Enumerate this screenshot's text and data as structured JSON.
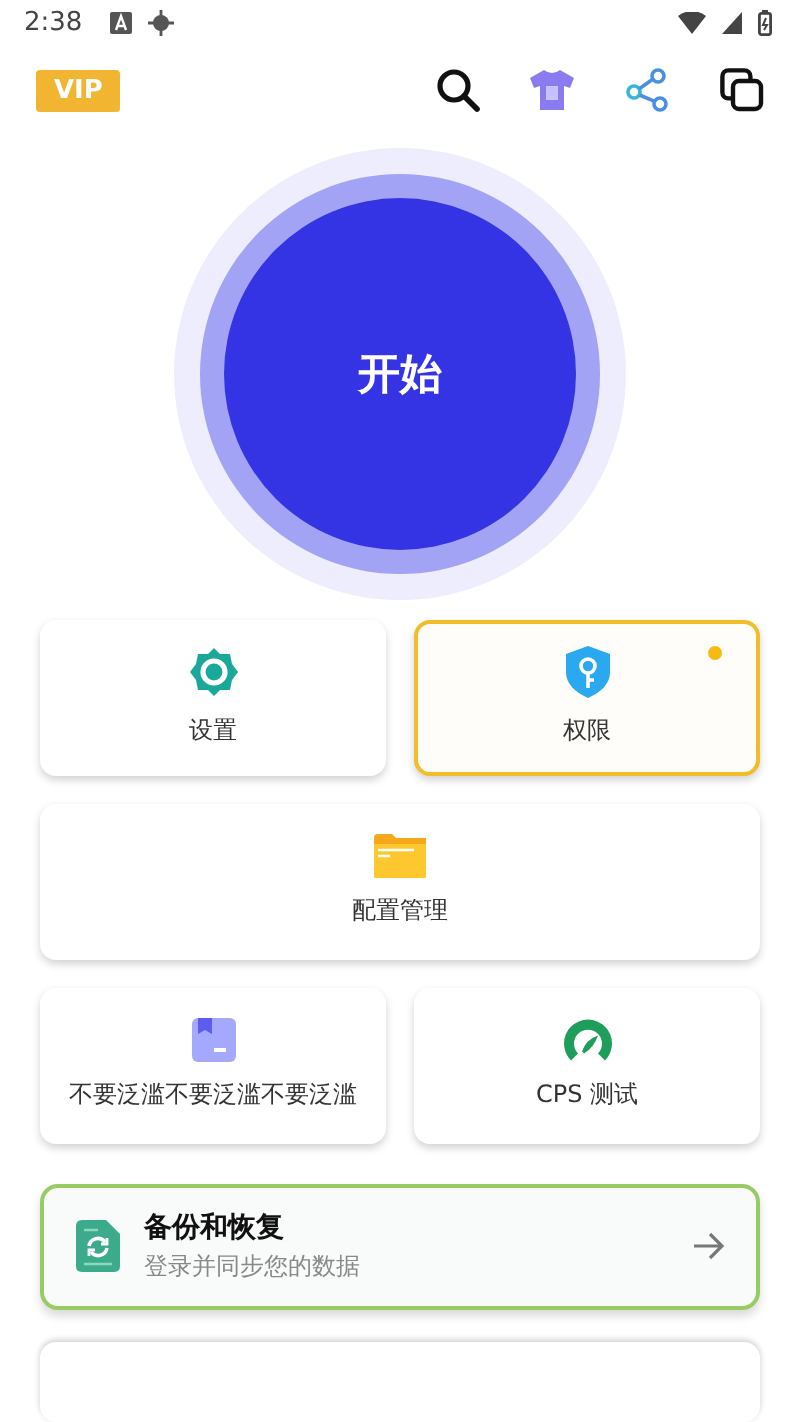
{
  "status_bar": {
    "time": "2:38"
  },
  "header": {
    "vip_label": "VIP"
  },
  "start_button": {
    "label": "开始"
  },
  "tiles": [
    {
      "kind": "settings",
      "label": "设置",
      "wide": false,
      "highlighted": false,
      "dot": false
    },
    {
      "kind": "permission",
      "label": "权限",
      "wide": false,
      "highlighted": true,
      "dot": true
    },
    {
      "kind": "config",
      "label": "配置管理",
      "wide": true,
      "highlighted": false,
      "dot": false
    },
    {
      "kind": "bookmark",
      "label": "不要泛滥不要泛滥不要泛滥",
      "wide": false,
      "highlighted": false,
      "dot": false
    },
    {
      "kind": "speed",
      "label": "CPS 测试",
      "wide": false,
      "highlighted": false,
      "dot": false
    }
  ],
  "backup_card": {
    "title": "备份和恢复",
    "subtitle": "登录并同步您的数据"
  }
}
